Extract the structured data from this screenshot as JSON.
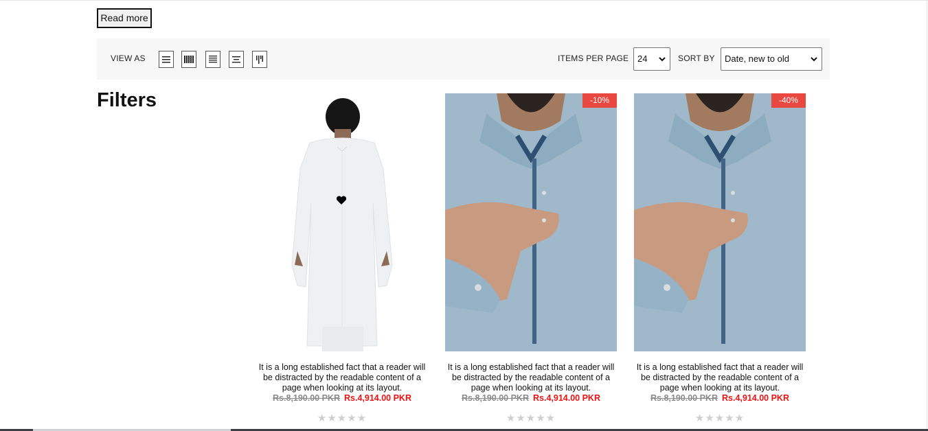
{
  "read_more": {
    "label": "Read more"
  },
  "toolbar": {
    "view_as_label": "VIEW AS",
    "view_modes": [
      {
        "icon": "list-view-icon"
      },
      {
        "icon": "grid-many-columns-icon"
      },
      {
        "icon": "justify-view-icon"
      },
      {
        "icon": "center-view-icon"
      },
      {
        "icon": "masonry-view-icon"
      }
    ],
    "items_per_page_label": "ITEMS PER PAGE",
    "items_per_page_value": "24",
    "sort_by_label": "SORT BY",
    "sort_by_value": "Date, new to old"
  },
  "filters": {
    "title": "Filters"
  },
  "products": [
    {
      "badge": "",
      "image": "white-kurta-back-view",
      "description": "It is a long established fact that a reader will be distracted by the readable content of a page when looking at its layout.",
      "old_price": "Rs.8,190.00 PKR",
      "new_price": "Rs.4,914.00 PKR",
      "rating_stars": 0,
      "wishlist_icon": "heart-icon"
    },
    {
      "badge": "-10%",
      "image": "light-blue-kurta-collar",
      "description": "It is a long established fact that a reader will be distracted by the readable content of a page when looking at its layout.",
      "old_price": "Rs.8,190.00 PKR",
      "new_price": "Rs.4,914.00 PKR",
      "rating_stars": 0
    },
    {
      "badge": "-40%",
      "image": "light-blue-kurta-collar",
      "description": "It is a long established fact that a reader will be distracted by the readable content of a page when looking at its layout.",
      "old_price": "Rs.8,190.00 PKR",
      "new_price": "Rs.4,914.00 PKR",
      "rating_stars": 0
    }
  ],
  "colors": {
    "toolbar_bg": "#f7f7f7",
    "badge_bg": "#e8483f",
    "sale_price": "#ee1111",
    "old_price": "#8a8a8a",
    "star_empty": "#cfcfcf"
  }
}
